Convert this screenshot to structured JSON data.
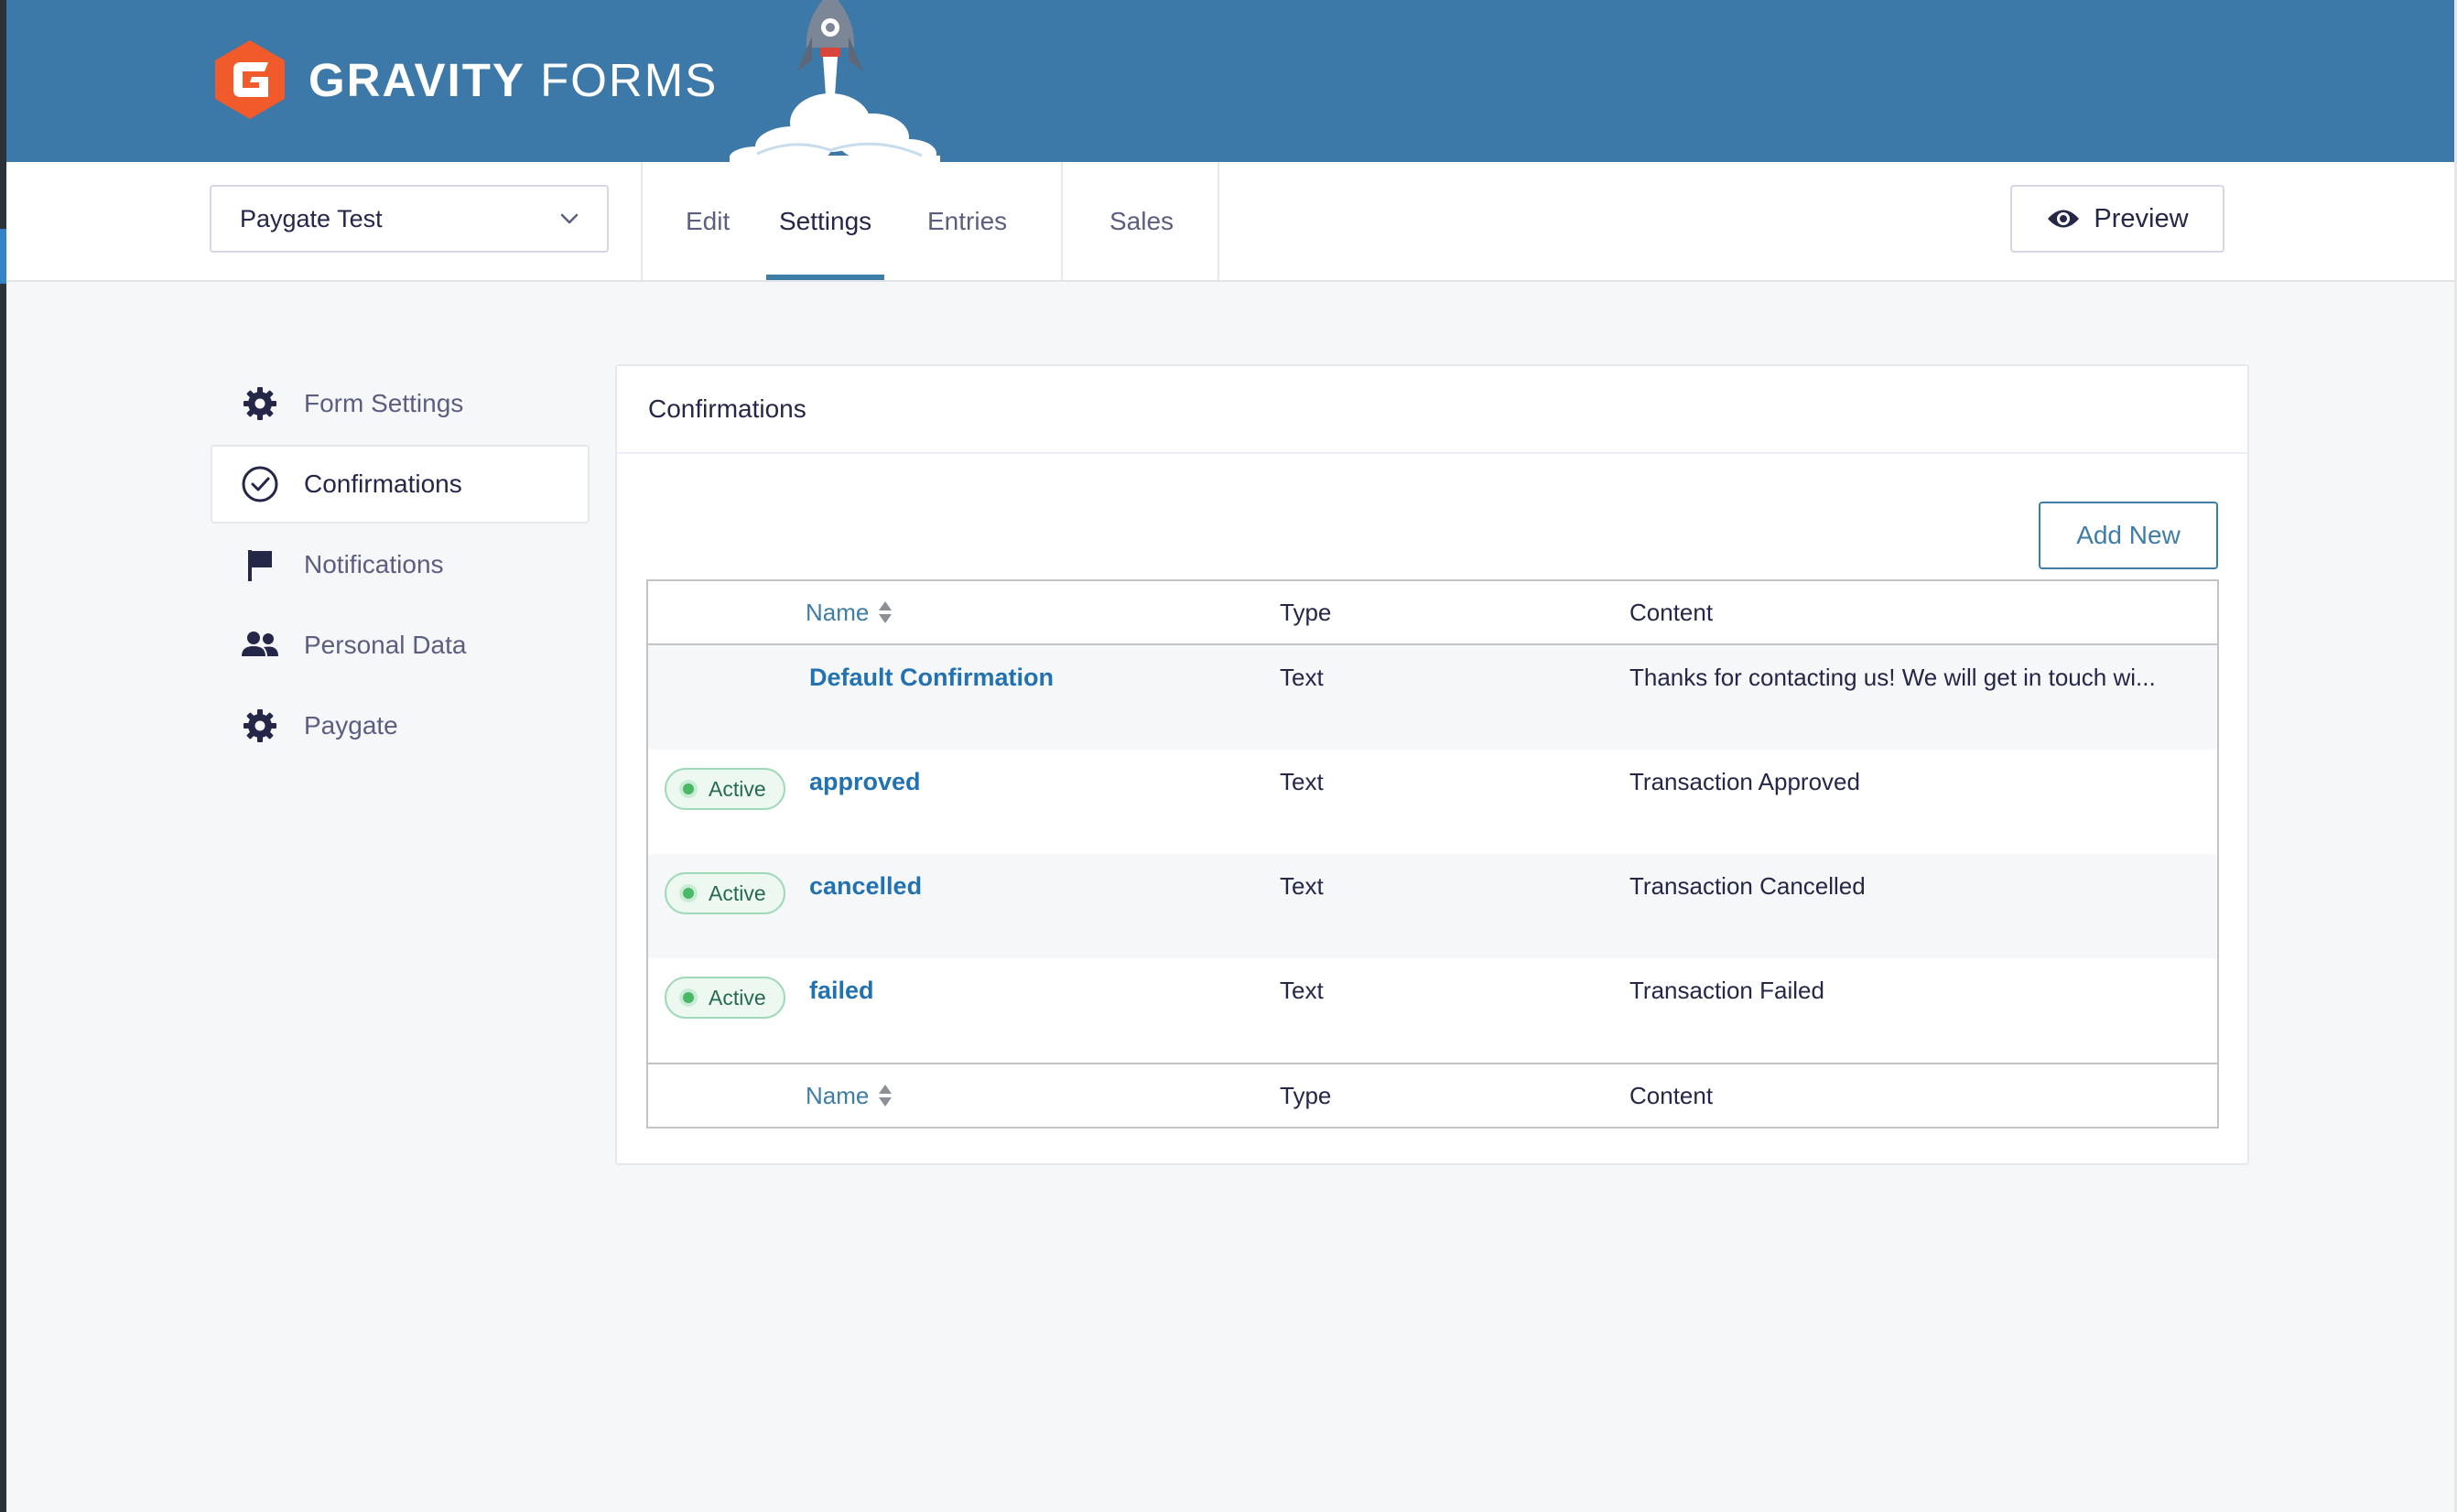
{
  "brand": {
    "name_bold": "GRAVITY",
    "name_light": "FORMS",
    "logo_color": "#f15a2b",
    "header_color": "#3d79a8"
  },
  "toolbar": {
    "form_selector": {
      "value": "Paygate Test"
    },
    "tabs": [
      {
        "label": "Edit",
        "active": false
      },
      {
        "label": "Settings",
        "active": true
      },
      {
        "label": "Entries",
        "active": false
      },
      {
        "label": "Sales",
        "active": false
      }
    ],
    "preview_label": "Preview"
  },
  "sidebar": {
    "items": [
      {
        "label": "Form Settings",
        "icon": "gear-icon",
        "active": false
      },
      {
        "label": "Confirmations",
        "icon": "check-circle-icon",
        "active": true
      },
      {
        "label": "Notifications",
        "icon": "flag-icon",
        "active": false
      },
      {
        "label": "Personal Data",
        "icon": "users-icon",
        "active": false
      },
      {
        "label": "Paygate",
        "icon": "gear-icon",
        "active": false
      }
    ]
  },
  "panel": {
    "title": "Confirmations",
    "add_new_label": "Add New",
    "columns": {
      "name": "Name",
      "type": "Type",
      "content": "Content"
    },
    "rows": [
      {
        "status": "",
        "name": "Default Confirmation",
        "type": "Text",
        "content": "Thanks for contacting us! We will get in touch wi..."
      },
      {
        "status": "Active",
        "name": "approved",
        "type": "Text",
        "content": "Transaction Approved"
      },
      {
        "status": "Active",
        "name": "cancelled",
        "type": "Text",
        "content": "Transaction Cancelled"
      },
      {
        "status": "Active",
        "name": "failed",
        "type": "Text",
        "content": "Transaction Failed"
      }
    ]
  }
}
